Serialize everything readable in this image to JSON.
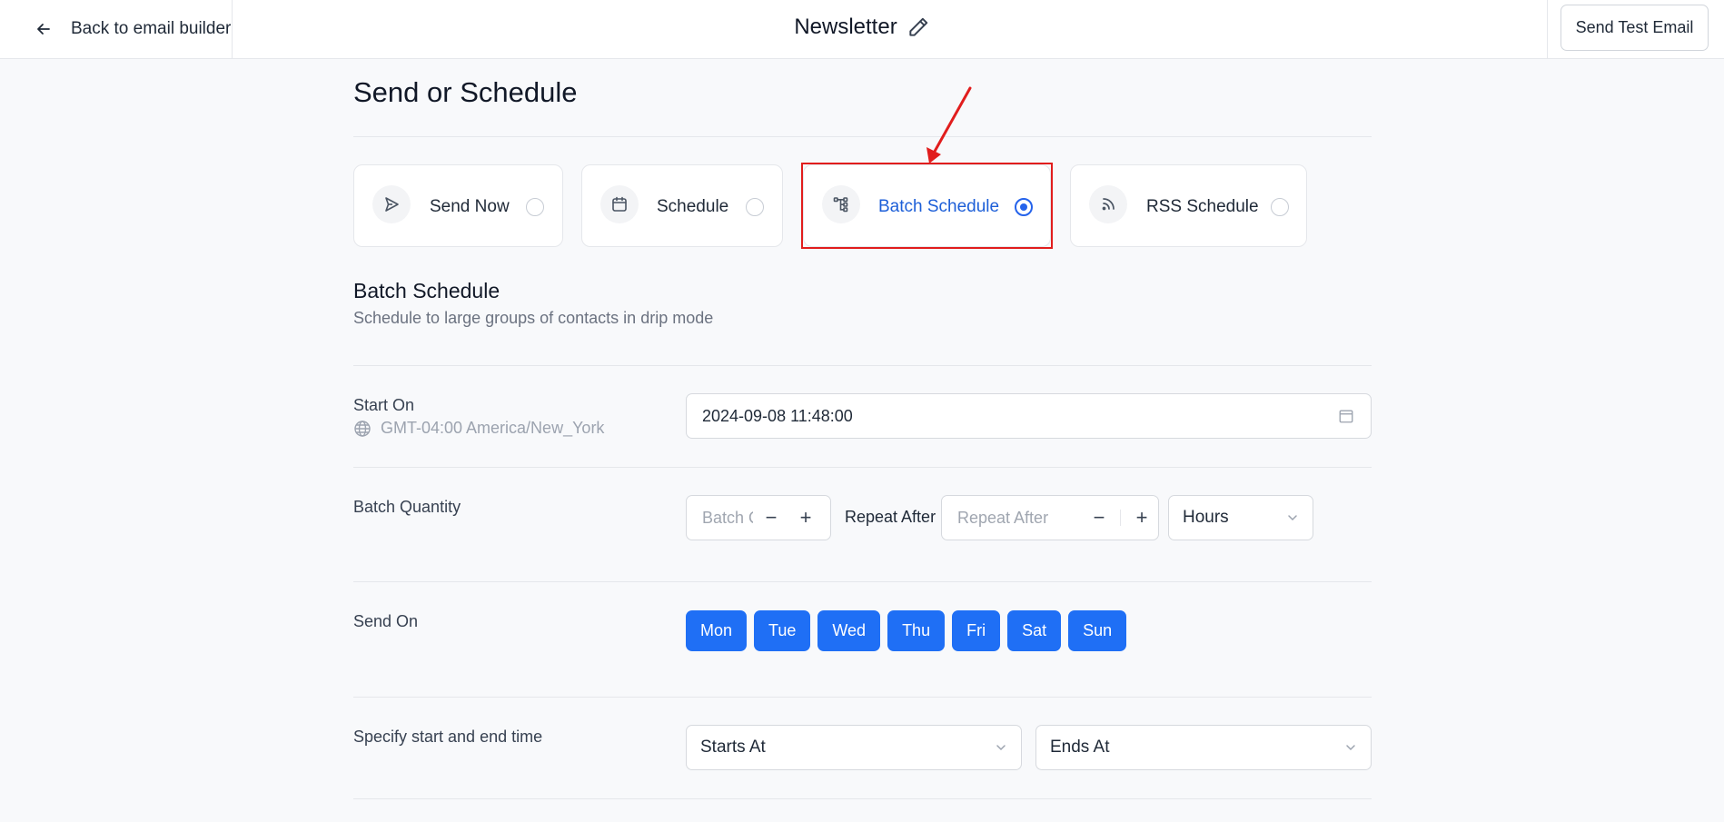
{
  "header": {
    "back_label": "Back to email builder",
    "title": "Newsletter",
    "send_test_label": "Send Test Email"
  },
  "page": {
    "heading": "Send or Schedule"
  },
  "options": [
    {
      "label": "Send Now",
      "icon": "send-icon",
      "selected": false
    },
    {
      "label": "Schedule",
      "icon": "calendar-icon",
      "selected": false
    },
    {
      "label": "Batch Schedule",
      "icon": "batch-tree-icon",
      "selected": true
    },
    {
      "label": "RSS Schedule",
      "icon": "rss-icon",
      "selected": false
    }
  ],
  "batch": {
    "title": "Batch Schedule",
    "subtitle": "Schedule to large groups of contacts in drip mode"
  },
  "start_on": {
    "label": "Start On",
    "timezone": "GMT-04:00 America/New_York",
    "value": "2024-09-08 11:48:00"
  },
  "batch_quantity": {
    "label": "Batch Quantity",
    "placeholder": "Batch Quantity",
    "repeat_label": "Repeat After",
    "repeat_placeholder": "Repeat After",
    "unit": "Hours"
  },
  "send_on": {
    "label": "Send On",
    "days": [
      "Mon",
      "Tue",
      "Wed",
      "Thu",
      "Fri",
      "Sat",
      "Sun"
    ]
  },
  "time_window": {
    "label": "Specify start and end time",
    "starts_at": "Starts At",
    "ends_at": "Ends At"
  },
  "colors": {
    "accent": "#1f6ff5",
    "selected_text": "#1d5fd8",
    "highlight": "#e11d1d"
  }
}
